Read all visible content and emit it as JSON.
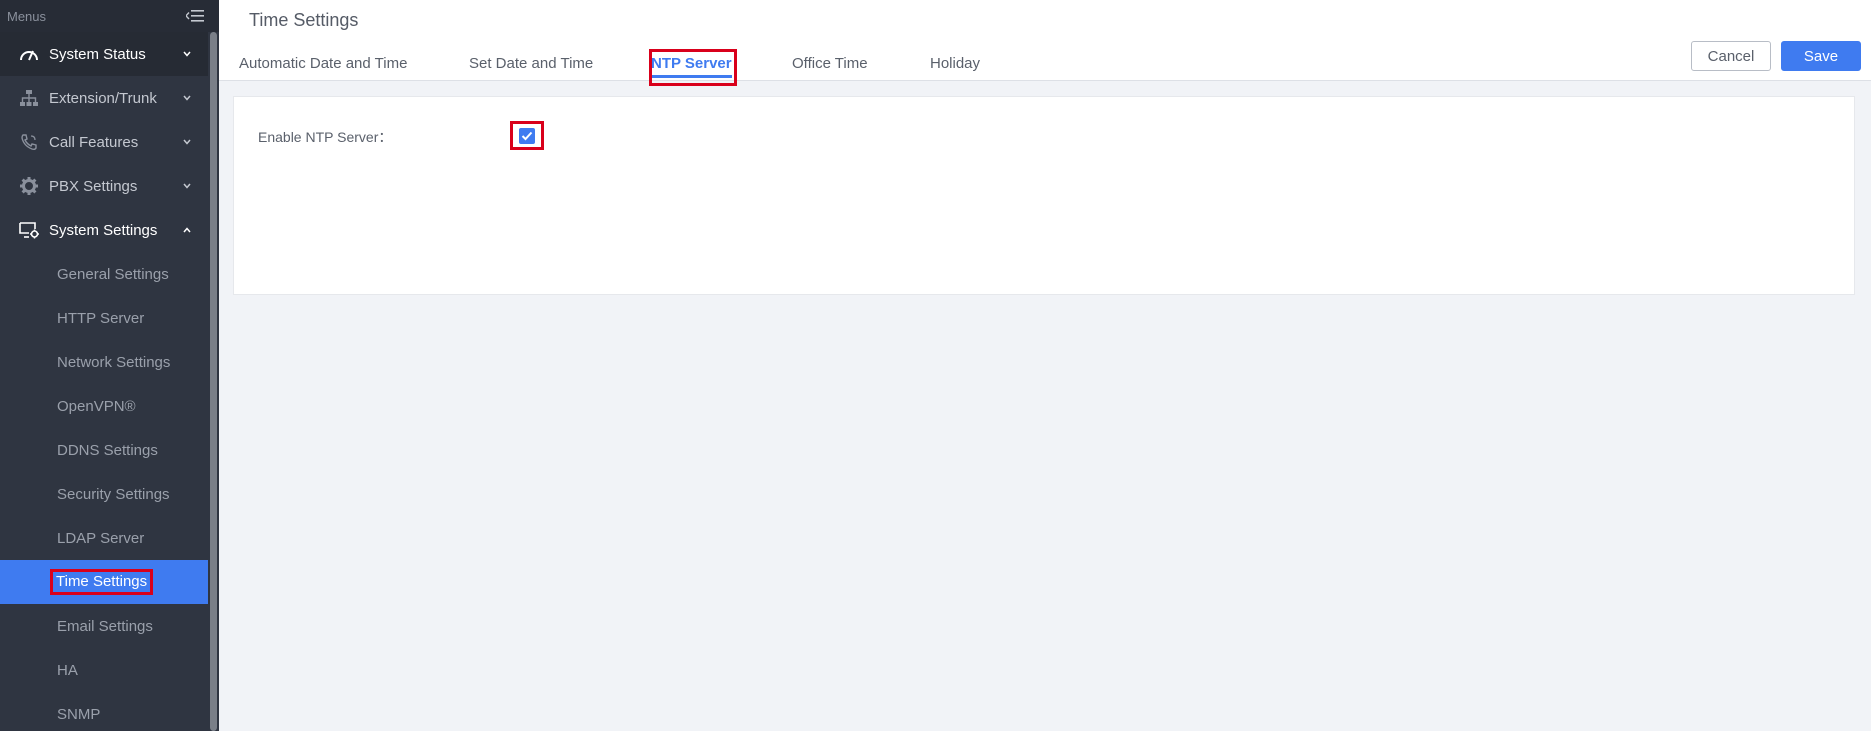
{
  "sidebar": {
    "header_label": "Menus",
    "items": [
      {
        "label": "System Status",
        "icon": "gauge-icon",
        "chevron": "down"
      },
      {
        "label": "Extension/Trunk",
        "icon": "network-icon",
        "chevron": "down"
      },
      {
        "label": "Call Features",
        "icon": "phone-icon",
        "chevron": "down"
      },
      {
        "label": "PBX Settings",
        "icon": "gear-icon",
        "chevron": "down"
      },
      {
        "label": "System Settings",
        "icon": "monitor-gear-icon",
        "chevron": "up"
      }
    ],
    "sub_items": [
      "General Settings",
      "HTTP Server",
      "Network Settings",
      "OpenVPN®",
      "DDNS Settings",
      "Security Settings",
      "LDAP Server",
      "Time Settings",
      "Email Settings",
      "HA",
      "SNMP"
    ],
    "active_sub_item": "Time Settings"
  },
  "header": {
    "title": "Time Settings",
    "tabs": [
      "Automatic Date and Time",
      "Set Date and Time",
      "NTP Server",
      "Office Time",
      "Holiday"
    ],
    "active_tab": "NTP Server",
    "cancel_label": "Cancel",
    "save_label": "Save"
  },
  "form": {
    "enable_ntp_label": "Enable NTP Server：",
    "enable_ntp_checked": true
  },
  "colors": {
    "accent": "#3f7bf0",
    "sidebar_bg": "#2f3541",
    "highlight": "#d9001b"
  }
}
